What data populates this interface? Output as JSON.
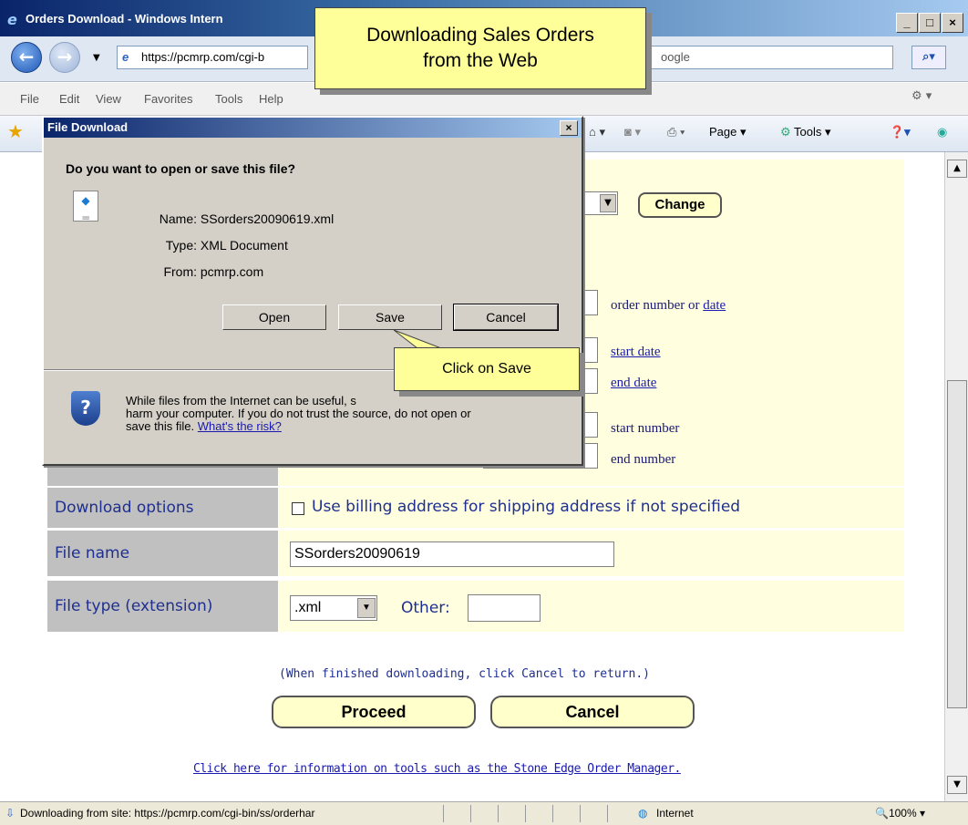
{
  "window": {
    "title": "Orders Download - Windows Intern"
  },
  "address": {
    "url": "https://pcmrp.com/cgi-b",
    "search_text": "oogle"
  },
  "menu": [
    "File",
    "Edit",
    "View",
    "Favorites",
    "Tools",
    "Help"
  ],
  "toolbar": {
    "page": "Page",
    "tools": "Tools"
  },
  "title_callout": {
    "line1": "Downloading Sales Orders",
    "line2": "from the Web"
  },
  "dialog": {
    "title": "File Download",
    "question": "Do you want to open or save this file?",
    "name_label": "Name:",
    "name_value": "SSorders20090619.xml",
    "type_label": "Type:",
    "type_value": "XML Document",
    "from_label": "From:",
    "from_value": "pcmrp.com",
    "open": "Open",
    "save": "Save",
    "cancel": "Cancel",
    "warning_line1": "While files from the Internet can be useful, s",
    "warning_line2": "harm your computer. If you do not trust the source, do not open or",
    "warning_line3": "save this file.",
    "risk_link": "What's the risk?"
  },
  "save_callout": "Click on Save",
  "form": {
    "change_button": "Change",
    "order_number_or": "order number or",
    "date_link": "date",
    "start_date": "start date",
    "end_date": "end date",
    "start_number": "start number",
    "end_number": "end number",
    "download_options_label": "Download options",
    "billing_checkbox": "Use billing address for shipping address if not specified",
    "file_name_label": "File name",
    "file_name_value": "SSorders20090619",
    "file_type_label": "File type (extension)",
    "file_type_value": ".xml",
    "other_label": "Other:",
    "other_value": "",
    "finished_note": "(When finished downloading, click Cancel to return.)",
    "proceed": "Proceed",
    "cancel": "Cancel",
    "tools_link": "Click here for information on tools such as the Stone Edge Order Manager."
  },
  "status": {
    "text": "Downloading from site: https://pcmrp.com/cgi-bin/ss/orderhar",
    "zone": "Internet",
    "zoom": "100%"
  }
}
